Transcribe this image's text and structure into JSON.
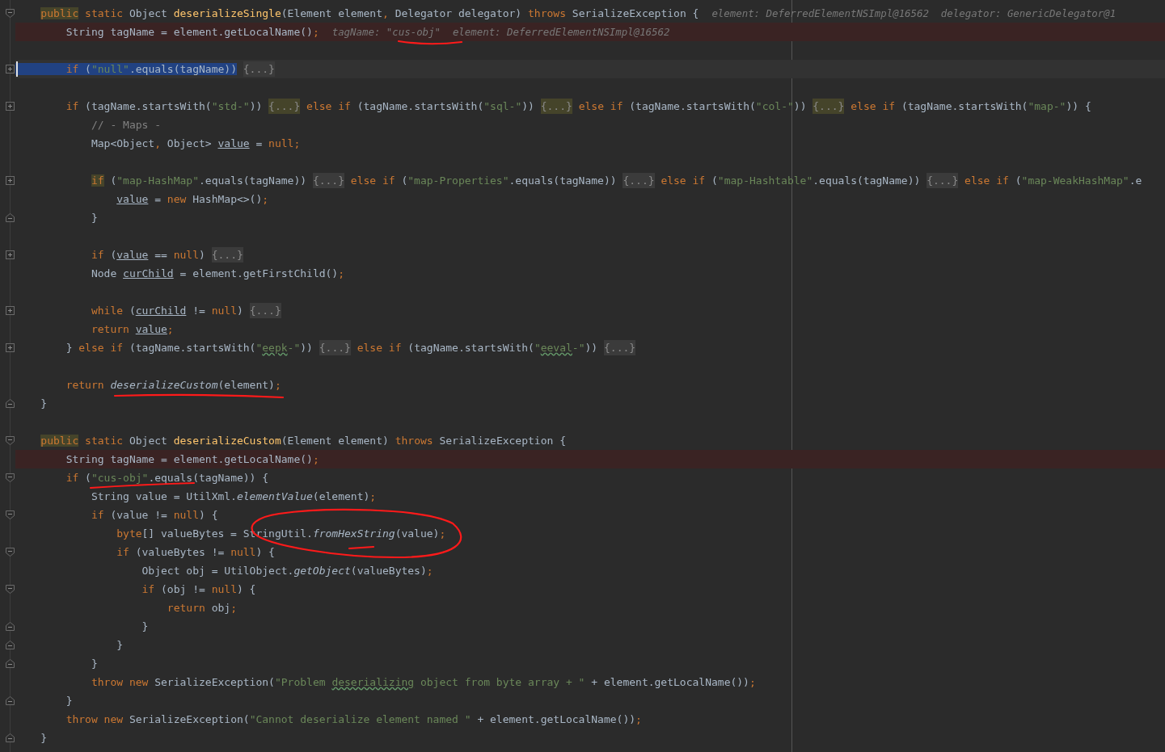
{
  "editor": {
    "lines": [
      {
        "kind": "plain",
        "fold_marker": {
          "kind": "open"
        },
        "tokens": [
          {
            "kind": "kwmark",
            "text": "    public"
          },
          {
            "kind": "kw",
            "text": " static "
          },
          {
            "kind": "plain",
            "text": "Object "
          },
          {
            "kind": "decl",
            "text": "deserializeSingle"
          },
          {
            "kind": "plain",
            "text": "(Element element"
          },
          {
            "kind": "kw",
            "text": ", "
          },
          {
            "kind": "plain",
            "text": "Delegator delegator) "
          },
          {
            "kind": "kw",
            "text": "throws "
          },
          {
            "kind": "plain",
            "text": "SerializeException {"
          }
        ],
        "hint": "element: DeferredElementNSImpl@16562  delegator: GenericDelegator@1"
      },
      {
        "kind": "breakpoint",
        "tokens": [
          {
            "kind": "plain",
            "text": "        String tagName = element.getLocalName()"
          },
          {
            "kind": "kw",
            "text": ";"
          }
        ],
        "hint": "tagName: \"cus-obj\"  element: DeferredElementNSImpl@16562"
      },
      {
        "kind": "plain"
      },
      {
        "kind": "caret",
        "fold_marker": {
          "kind": "collapsed"
        },
        "tokens": [
          {
            "kind": "kwsel",
            "text": "        if "
          },
          {
            "kind": "plainsel",
            "text": "("
          },
          {
            "kind": "strsel",
            "text": "\"null\""
          },
          {
            "kind": "plainsel",
            "text": ".equals(tagName))"
          },
          {
            "kind": "fold",
            "text": " {...}"
          }
        ]
      },
      {
        "kind": "plain"
      },
      {
        "kind": "plain",
        "fold_marker": {
          "kind": "collapsed"
        },
        "tokens": [
          {
            "kind": "kw",
            "text": "        if "
          },
          {
            "kind": "plain",
            "text": "(tagName.startsWith("
          },
          {
            "kind": "str",
            "text": "\"std-\""
          },
          {
            "kind": "plain",
            "text": ")) "
          },
          {
            "kind": "foldmark",
            "text": "{...}"
          },
          {
            "kind": "kw",
            "text": " else if "
          },
          {
            "kind": "plain",
            "text": "(tagName.startsWith("
          },
          {
            "kind": "str",
            "text": "\"sql-\""
          },
          {
            "kind": "plain",
            "text": ")) "
          },
          {
            "kind": "foldmark",
            "text": "{...}"
          },
          {
            "kind": "kw",
            "text": " else if "
          },
          {
            "kind": "plain",
            "text": "(tagName.startsWith("
          },
          {
            "kind": "str",
            "text": "\"col-\""
          },
          {
            "kind": "plain",
            "text": ")) "
          },
          {
            "kind": "foldmark",
            "text": "{...}"
          },
          {
            "kind": "kw",
            "text": " else if "
          },
          {
            "kind": "plain",
            "text": "(tagName.startsWith("
          },
          {
            "kind": "str",
            "text": "\"map-\""
          },
          {
            "kind": "plain",
            "text": ")) {"
          }
        ]
      },
      {
        "kind": "plain",
        "tokens": [
          {
            "kind": "comment",
            "text": "            // - Maps -"
          }
        ]
      },
      {
        "kind": "plain",
        "tokens": [
          {
            "kind": "plain",
            "text": "            Map<Object"
          },
          {
            "kind": "kw",
            "text": ","
          },
          {
            "kind": "plain",
            "text": " Object> "
          },
          {
            "kind": "var",
            "text": "value"
          },
          {
            "kind": "plain",
            "text": " = "
          },
          {
            "kind": "kw",
            "text": "null;"
          }
        ]
      },
      {
        "kind": "plain"
      },
      {
        "kind": "plain",
        "fold_marker": {
          "kind": "collapsed"
        },
        "tokens": [
          {
            "kind": "kwmark",
            "text": "            if"
          },
          {
            "kind": "plain",
            "text": " ("
          },
          {
            "kind": "str",
            "text": "\"map-HashMap\""
          },
          {
            "kind": "plain",
            "text": ".equals(tagName)) "
          },
          {
            "kind": "fold",
            "text": "{...}"
          },
          {
            "kind": "kw",
            "text": " else if "
          },
          {
            "kind": "plain",
            "text": "("
          },
          {
            "kind": "str",
            "text": "\"map-Properties\""
          },
          {
            "kind": "plain",
            "text": ".equals(tagName)) "
          },
          {
            "kind": "fold",
            "text": "{...}"
          },
          {
            "kind": "kw",
            "text": " else if "
          },
          {
            "kind": "plain",
            "text": "("
          },
          {
            "kind": "str",
            "text": "\"map-Hashtable\""
          },
          {
            "kind": "plain",
            "text": ".equals(tagName)) "
          },
          {
            "kind": "fold",
            "text": "{...}"
          },
          {
            "kind": "kw",
            "text": " else if "
          },
          {
            "kind": "plain",
            "text": "("
          },
          {
            "kind": "str",
            "text": "\"map-WeakHashMap\""
          },
          {
            "kind": "plain",
            "text": ".e"
          }
        ]
      },
      {
        "kind": "plain",
        "tokens": [
          {
            "kind": "var",
            "text": "                value"
          },
          {
            "kind": "plain",
            "text": " = "
          },
          {
            "kind": "kw",
            "text": "new "
          },
          {
            "kind": "plain",
            "text": "HashMap<>()"
          },
          {
            "kind": "kw",
            "text": ";"
          }
        ]
      },
      {
        "kind": "plain",
        "fold_marker": {
          "kind": "end"
        },
        "tokens": [
          {
            "kind": "plain",
            "text": "            }"
          }
        ]
      },
      {
        "kind": "plain"
      },
      {
        "kind": "plain",
        "fold_marker": {
          "kind": "collapsed"
        },
        "tokens": [
          {
            "kind": "kw",
            "text": "            if "
          },
          {
            "kind": "plain",
            "text": "("
          },
          {
            "kind": "var",
            "text": "value"
          },
          {
            "kind": "plain",
            "text": " == "
          },
          {
            "kind": "kw",
            "text": "null"
          },
          {
            "kind": "plain",
            "text": ") "
          },
          {
            "kind": "fold",
            "text": "{...}"
          }
        ]
      },
      {
        "kind": "plain",
        "tokens": [
          {
            "kind": "plain",
            "text": "            Node "
          },
          {
            "kind": "var",
            "text": "curChild"
          },
          {
            "kind": "plain",
            "text": " = element.getFirstChild()"
          },
          {
            "kind": "kw",
            "text": ";"
          }
        ]
      },
      {
        "kind": "plain"
      },
      {
        "kind": "plain",
        "fold_marker": {
          "kind": "collapsed"
        },
        "tokens": [
          {
            "kind": "kw",
            "text": "            while "
          },
          {
            "kind": "plain",
            "text": "("
          },
          {
            "kind": "var",
            "text": "curChild"
          },
          {
            "kind": "plain",
            "text": " != "
          },
          {
            "kind": "kw",
            "text": "null"
          },
          {
            "kind": "plain",
            "text": ") "
          },
          {
            "kind": "fold",
            "text": "{...}"
          }
        ]
      },
      {
        "kind": "plain",
        "tokens": [
          {
            "kind": "kw",
            "text": "            return "
          },
          {
            "kind": "var",
            "text": "value"
          },
          {
            "kind": "kw",
            "text": ";"
          }
        ]
      },
      {
        "kind": "plain",
        "fold_marker": {
          "kind": "collapsed"
        },
        "tokens": [
          {
            "kind": "plain",
            "text": "        } "
          },
          {
            "kind": "kw",
            "text": "else if "
          },
          {
            "kind": "plain",
            "text": "(tagName.startsWith("
          },
          {
            "kind": "str",
            "text": "\""
          },
          {
            "kind": "typo",
            "text": "eepk"
          },
          {
            "kind": "str",
            "text": "-\""
          },
          {
            "kind": "plain",
            "text": ")) "
          },
          {
            "kind": "fold",
            "text": "{...}"
          },
          {
            "kind": "kw",
            "text": " else if "
          },
          {
            "kind": "plain",
            "text": "(tagName.startsWith("
          },
          {
            "kind": "str",
            "text": "\""
          },
          {
            "kind": "typo",
            "text": "eeval"
          },
          {
            "kind": "str",
            "text": "-\""
          },
          {
            "kind": "plain",
            "text": ")) "
          },
          {
            "kind": "fold",
            "text": "{...}"
          }
        ]
      },
      {
        "kind": "plain"
      },
      {
        "kind": "plain",
        "tokens": [
          {
            "kind": "kw",
            "text": "        return "
          },
          {
            "kind": "static",
            "text": "deserializeCustom"
          },
          {
            "kind": "plain",
            "text": "(element)"
          },
          {
            "kind": "kw",
            "text": ";"
          }
        ]
      },
      {
        "kind": "plain",
        "fold_marker": {
          "kind": "end"
        },
        "tokens": [
          {
            "kind": "plain",
            "text": "    }"
          }
        ]
      },
      {
        "kind": "plain"
      },
      {
        "kind": "plain",
        "fold_marker": {
          "kind": "open"
        },
        "tokens": [
          {
            "kind": "kwmark",
            "text": "    public"
          },
          {
            "kind": "kw",
            "text": " static "
          },
          {
            "kind": "plain",
            "text": "Object "
          },
          {
            "kind": "decl",
            "text": "deserializeCustom"
          },
          {
            "kind": "plain",
            "text": "(Element element) "
          },
          {
            "kind": "kw",
            "text": "throws "
          },
          {
            "kind": "plain",
            "text": "SerializeException {"
          }
        ]
      },
      {
        "kind": "breakpoint",
        "tokens": [
          {
            "kind": "plain",
            "text": "        String tagName = element.getLocalName()"
          },
          {
            "kind": "kw",
            "text": ";"
          }
        ]
      },
      {
        "kind": "plain",
        "fold_marker": {
          "kind": "open"
        },
        "tokens": [
          {
            "kind": "kw",
            "text": "        if "
          },
          {
            "kind": "plain",
            "text": "("
          },
          {
            "kind": "str",
            "text": "\"cus-obj\""
          },
          {
            "kind": "plain",
            "text": ".equals(tagName)) {"
          }
        ]
      },
      {
        "kind": "plain",
        "tokens": [
          {
            "kind": "plain",
            "text": "            String value = UtilXml."
          },
          {
            "kind": "static",
            "text": "elementValue"
          },
          {
            "kind": "plain",
            "text": "(element)"
          },
          {
            "kind": "kw",
            "text": ";"
          }
        ]
      },
      {
        "kind": "plain",
        "fold_marker": {
          "kind": "open"
        },
        "tokens": [
          {
            "kind": "kw",
            "text": "            if "
          },
          {
            "kind": "plain",
            "text": "(value != "
          },
          {
            "kind": "kw",
            "text": "null"
          },
          {
            "kind": "plain",
            "text": ") {"
          }
        ]
      },
      {
        "kind": "plain",
        "tokens": [
          {
            "kind": "kw",
            "text": "                byte"
          },
          {
            "kind": "plain",
            "text": "[] valueBytes = StringUtil."
          },
          {
            "kind": "static",
            "text": "fromHexString"
          },
          {
            "kind": "plain",
            "text": "(value)"
          },
          {
            "kind": "kw",
            "text": ";"
          }
        ]
      },
      {
        "kind": "plain",
        "fold_marker": {
          "kind": "open"
        },
        "tokens": [
          {
            "kind": "kw",
            "text": "                if "
          },
          {
            "kind": "plain",
            "text": "(valueBytes != "
          },
          {
            "kind": "kw",
            "text": "null"
          },
          {
            "kind": "plain",
            "text": ") {"
          }
        ]
      },
      {
        "kind": "plain",
        "tokens": [
          {
            "kind": "plain",
            "text": "                    Object obj = UtilObject."
          },
          {
            "kind": "static",
            "text": "getObject"
          },
          {
            "kind": "plain",
            "text": "(valueBytes)"
          },
          {
            "kind": "kw",
            "text": ";"
          }
        ]
      },
      {
        "kind": "plain",
        "fold_marker": {
          "kind": "open"
        },
        "tokens": [
          {
            "kind": "kw",
            "text": "                    if "
          },
          {
            "kind": "plain",
            "text": "(obj != "
          },
          {
            "kind": "kw",
            "text": "null"
          },
          {
            "kind": "plain",
            "text": ") {"
          }
        ]
      },
      {
        "kind": "plain",
        "tokens": [
          {
            "kind": "kw",
            "text": "                        return "
          },
          {
            "kind": "plain",
            "text": "obj"
          },
          {
            "kind": "kw",
            "text": ";"
          }
        ]
      },
      {
        "kind": "plain",
        "fold_marker": {
          "kind": "end"
        },
        "tokens": [
          {
            "kind": "plain",
            "text": "                    }"
          }
        ]
      },
      {
        "kind": "plain",
        "fold_marker": {
          "kind": "end"
        },
        "tokens": [
          {
            "kind": "plain",
            "text": "                }"
          }
        ]
      },
      {
        "kind": "plain",
        "fold_marker": {
          "kind": "end"
        },
        "tokens": [
          {
            "kind": "plain",
            "text": "            }"
          }
        ]
      },
      {
        "kind": "plain",
        "tokens": [
          {
            "kind": "kw",
            "text": "            throw new "
          },
          {
            "kind": "plain",
            "text": "SerializeException("
          },
          {
            "kind": "str",
            "text": "\"Problem "
          },
          {
            "kind": "typo",
            "text": "deserializing"
          },
          {
            "kind": "str",
            "text": " object from byte array + \""
          },
          {
            "kind": "plain",
            "text": " + element.getLocalName())"
          },
          {
            "kind": "kw",
            "text": ";"
          }
        ]
      },
      {
        "kind": "plain",
        "fold_marker": {
          "kind": "end"
        },
        "tokens": [
          {
            "kind": "plain",
            "text": "        }"
          }
        ]
      },
      {
        "kind": "plain",
        "tokens": [
          {
            "kind": "kw",
            "text": "        throw new "
          },
          {
            "kind": "plain",
            "text": "SerializeException("
          },
          {
            "kind": "str",
            "text": "\"Cannot deserialize element named \""
          },
          {
            "kind": "plain",
            "text": " + element.getLocalName())"
          },
          {
            "kind": "kw",
            "text": ";"
          }
        ]
      },
      {
        "kind": "plain",
        "fold_marker": {
          "kind": "end"
        },
        "tokens": [
          {
            "kind": "plain",
            "text": "    }"
          }
        ]
      }
    ]
  }
}
